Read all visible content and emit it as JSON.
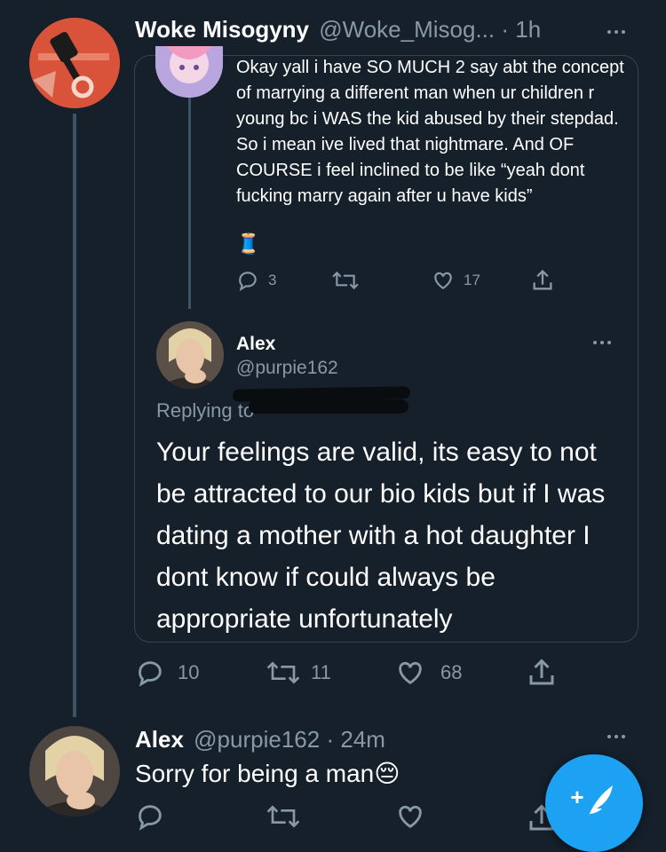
{
  "top_tweet": {
    "display_name": "Woke Misogyny",
    "handle": "@Woke_Misog...",
    "separator": "·",
    "time": "1h",
    "stats": {
      "replies": "10",
      "retweets": "11",
      "likes": "68"
    }
  },
  "parent_tweet": {
    "text": "Okay yall i have SO MUCH 2 say abt the concept of marrying a different man when ur children r young bc i WAS the kid abused by their stepdad. So i mean ive lived that nightmare. And OF COURSE i feel inclined to be like “yeah dont fucking marry again after u have kids”",
    "emoji": "🧵",
    "stats": {
      "replies": "3",
      "retweets": "",
      "likes": "17"
    }
  },
  "quoted_tweet": {
    "display_name": "Alex",
    "handle": "@purpie162",
    "replying_to": "Replying to",
    "text": "Your feelings are valid, its easy to not be attracted to our bio kids but if I was dating a mother with a hot daughter I dont know if could always be appropriate unfortunately"
  },
  "reply_tweet": {
    "display_name": "Alex",
    "handle": "@purpie162",
    "separator": "·",
    "time": "24m",
    "text": "Sorry for being a man",
    "emoji": "😔"
  },
  "fab": {
    "label": "+"
  },
  "colors": {
    "background": "#15202b",
    "muted": "#8899a6",
    "border": "#38444d",
    "accent": "#1da1f2"
  }
}
